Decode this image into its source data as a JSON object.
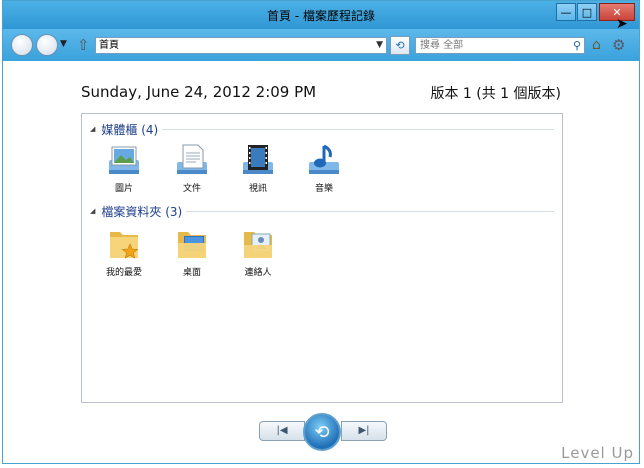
{
  "window": {
    "title": "首頁 - 檔案歷程記錄"
  },
  "title_buttons": {
    "minimize": "—",
    "maximize": "□",
    "close": "✕"
  },
  "toolbar": {
    "address": "首頁",
    "search_placeholder": "搜尋 全部"
  },
  "header": {
    "date": "Sunday, June 24, 2012 2:09 PM",
    "version": "版本 1 (共 1 個版本)"
  },
  "groups": [
    {
      "label": "媒體櫃 (4)",
      "items": [
        {
          "label": "圖片",
          "icon": "pictures-library-icon"
        },
        {
          "label": "文件",
          "icon": "documents-library-icon"
        },
        {
          "label": "視訊",
          "icon": "videos-library-icon"
        },
        {
          "label": "音樂",
          "icon": "music-library-icon"
        }
      ]
    },
    {
      "label": "檔案資料夾 (3)",
      "items": [
        {
          "label": "我的最愛",
          "icon": "favorites-folder-icon"
        },
        {
          "label": "桌面",
          "icon": "desktop-folder-icon"
        },
        {
          "label": "連絡人",
          "icon": "contacts-folder-icon"
        }
      ]
    }
  ],
  "watermark": "Level Up"
}
